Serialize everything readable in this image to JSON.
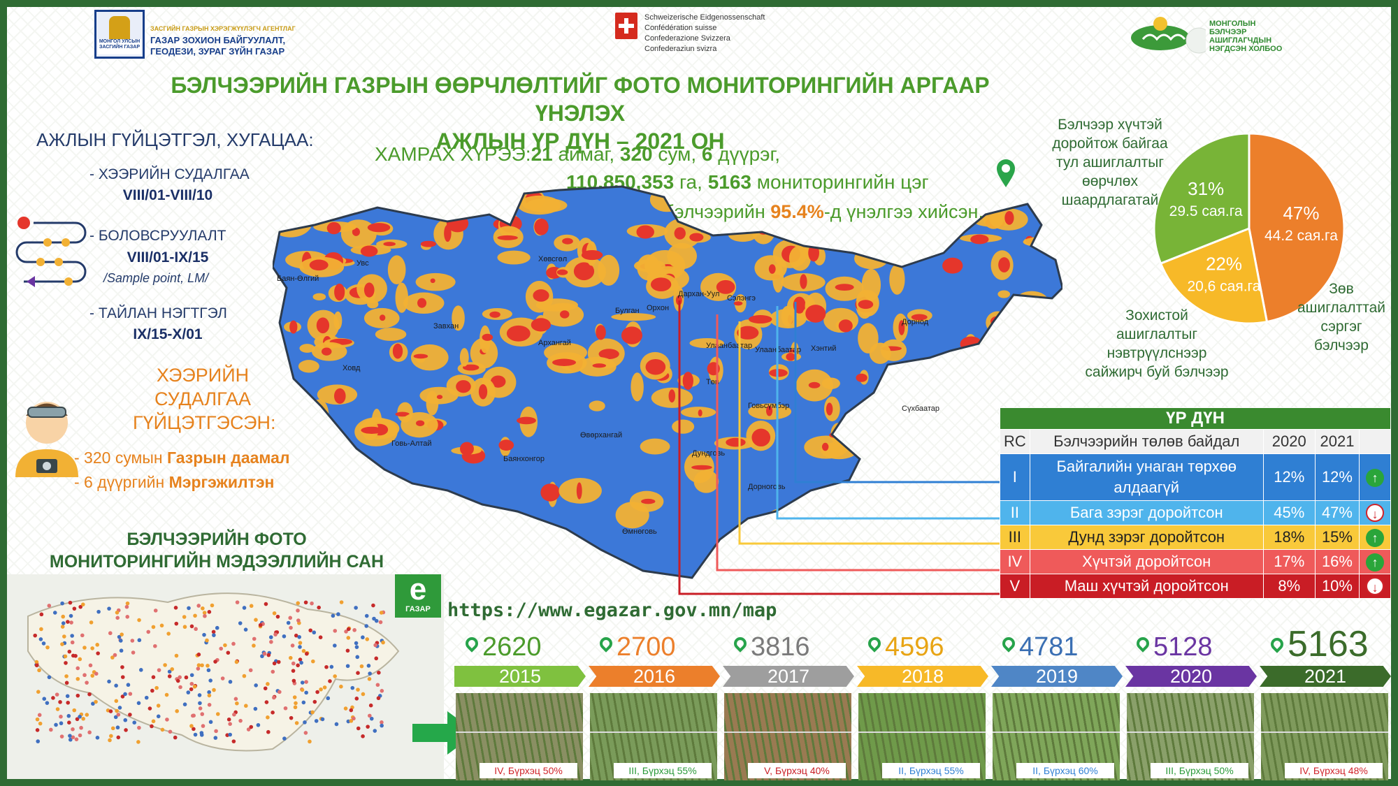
{
  "header": {
    "agency_small": "ЗАСГИЙН ГАЗРЫН ХЭРЭГЖҮҮЛЭГЧ АГЕНТЛАГ",
    "agency_line1": "ГАЗАР  ЗОХИОН  БАЙГУУЛАЛТ,",
    "agency_line2": "ГЕОДЕЗИ, ЗУРАГ ЗҮЙН ГАЗАР",
    "emblem_caption": "МОНГОЛ УЛСЫН ЗАСГИЙН ГАЗАР",
    "swiss_lines": [
      "Schweizerische Eidgenossenschaft",
      "Confédération suisse",
      "Confederazione Svizzera",
      "Confederaziun svizra"
    ],
    "assoc_lines": [
      "МОНГОЛЫН",
      "БЭЛЧЭЭР АШИГЛАГЧДЫН",
      "НЭГДСЭН ХОЛБОО"
    ]
  },
  "title": {
    "line1": "БЭЛЧЭЭРИЙН ГАЗРЫН ӨӨРЧЛӨЛТИЙГ ФОТО МОНИТОРИНГИЙН АРГААР ҮНЭЛЭХ",
    "line2": "АЖЛЫН ҮР ДҮН – 2021 ОН"
  },
  "schedule": {
    "title": "АЖЛЫН ГҮЙЦЭТГЭЛ, ХУГАЦАА:",
    "steps": [
      {
        "label": "- ХЭЭРИЙН СУДАЛГАА",
        "date": "VIII/01-VIII/10"
      },
      {
        "label": "- БОЛОВСРУУЛАЛТ",
        "date": "VIII/01-IX/15"
      },
      {
        "label": "- ТАЙЛАН НЭГТГЭЛ",
        "date": "IX/15-X/01"
      }
    ],
    "note": "/Sample point, LM/"
  },
  "field": {
    "heading": [
      "ХЭЭРИЙН",
      "СУДАЛГАА",
      "ГҮЙЦЭТГЭСЭН:"
    ],
    "line1_pre": "-  320 сумын ",
    "line1_b": "Газрын даамал",
    "line2_pre": "-  6 дүүргийн ",
    "line2_b": "Мэргэжилтэн"
  },
  "coverage": {
    "label": "ХАМРАХ ХҮРЭЭ:",
    "aimag_n": "21",
    "aimag": " аймаг, ",
    "sum_n": "320",
    "sum": " сум, ",
    "duureg_n": "6",
    "duureg": " дүүрэг,",
    "area": "110,850,353",
    "area_unit": " га, ",
    "points": "5163",
    "points_unit": " мониторингийн  цэг",
    "pct_pre": "Нийт бэлчээрийн ",
    "pct": "95.4%",
    "pct_post": "-д үнэлгээ хийсэн."
  },
  "map": {
    "provinces": [
      "Увс",
      "Баян-Өлгий",
      "Ховд",
      "Завхан",
      "Хөвсгөл",
      "Булган",
      "Орхон",
      "Дархан-Уул",
      "Сэлэнгэ",
      "Архангай",
      "Улаанбаатар",
      "Улаанбаатар",
      "Төв",
      "Хэнтий",
      "Дорнод",
      "Сүхбаатар",
      "Говь-Алтай",
      "Баянхонгор",
      "Өвөрхангай",
      "Дундговь",
      "Говьсүмбэр",
      "Дорноговь",
      "Өмнөговь"
    ],
    "colors": {
      "blue": "#3c78d8",
      "yellow": "#f2b134",
      "red": "#e5362b"
    }
  },
  "chart_data": {
    "type": "pie",
    "slices": [
      {
        "pct_label": "47%",
        "area_label": "44.2 сая.га",
        "value": 47,
        "color": "#ec7f2b"
      },
      {
        "pct_label": "22%",
        "area_label": "20,6 сая.га",
        "value": 22,
        "color": "#f7b928"
      },
      {
        "pct_label": "31%",
        "area_label": "29.5 сая.га",
        "value": 31,
        "color": "#78b437"
      }
    ],
    "annotations": [
      [
        "Бэлчээр хүчтэй",
        "доройтож байгаа",
        "тул ашиглалтыг",
        "өөрчлөх",
        "шаардлагатай"
      ],
      [
        "Зөв",
        "ашиглалттай",
        "сэргэг",
        "бэлчээр"
      ],
      [
        "Зохистой",
        "ашиглалтыг",
        "нэвтрүүлснээр",
        "сайжирч буй бэлчээр"
      ]
    ]
  },
  "results": {
    "title": "ҮР ДҮН",
    "headers": [
      "RC",
      "Бэлчээрийн төлөв байдал",
      "2020",
      "2021"
    ],
    "rows": [
      {
        "rc": "I",
        "name": "Байгалийн унаган төрхөө алдаагүй",
        "y2020": "12%",
        "y2021": "12%",
        "trend": "↑",
        "bg": "#2f7fd3",
        "color": "#ffffff"
      },
      {
        "rc": "II",
        "name": "Бага зэрэг доройтсон",
        "y2020": "45%",
        "y2021": "47%",
        "trend": "↓",
        "bg": "#4fb4ec",
        "color": "#ffffff"
      },
      {
        "rc": "III",
        "name": "Дунд зэрэг доройтсон",
        "y2020": "18%",
        "y2021": "15%",
        "trend": "↑",
        "bg": "#f9c93a",
        "color": "#222222"
      },
      {
        "rc": "IV",
        "name": "Хүчтэй доройтсон",
        "y2020": "17%",
        "y2021": "16%",
        "trend": "↑",
        "bg": "#ef5a5a",
        "color": "#ffffff"
      },
      {
        "rc": "V",
        "name": "Маш хүчтэй доройтсон",
        "y2020": "8%",
        "y2021": "10%",
        "trend": "↓",
        "bg": "#c91d25",
        "color": "#ffffff"
      }
    ]
  },
  "database": {
    "title": [
      "БЭЛЧЭЭРИЙН ФОТО",
      "МОНИТОРИНГИЙН МЭДЭЭЛЛИЙН САН"
    ],
    "logo_letter": "e",
    "logo_text": "ГАЗАР",
    "url": "https://www.egazar.gov.mn/map"
  },
  "timeline": [
    {
      "year": "2015",
      "count": "2620",
      "color": "#7fc13f",
      "count_color": "#4b9b2b",
      "caption": "IV, Бүрхэц 50%",
      "cap_color": "#d0242b"
    },
    {
      "year": "2016",
      "count": "2700",
      "color": "#ec7f2b",
      "count_color": "#ec7f2b",
      "caption": "III, Бүрхэц 55%",
      "cap_color": "#2a9a3a"
    },
    {
      "year": "2017",
      "count": "3816",
      "color": "#9e9e9e",
      "count_color": "#7a7a7a",
      "caption": "V, Бүрхэц 40%",
      "cap_color": "#c91d25"
    },
    {
      "year": "2018",
      "count": "4596",
      "color": "#f7b928",
      "count_color": "#e8a414",
      "caption": "II, Бүрхэц 55%",
      "cap_color": "#2f7fd3"
    },
    {
      "year": "2019",
      "count": "4781",
      "color": "#4f86c6",
      "count_color": "#3a6fb3",
      "caption": "II, Бүрхэц 60%",
      "cap_color": "#2f7fd3"
    },
    {
      "year": "2020",
      "count": "5128",
      "color": "#6a35a2",
      "count_color": "#6a35a2",
      "caption": "III, Бүрхэц 50%",
      "cap_color": "#2a9a3a"
    },
    {
      "year": "2021",
      "count": "5163",
      "color": "#3b6b2a",
      "count_color": "#3b6b2a",
      "caption": "IV, Бүрхэц 48%",
      "cap_color": "#d0242b"
    }
  ]
}
